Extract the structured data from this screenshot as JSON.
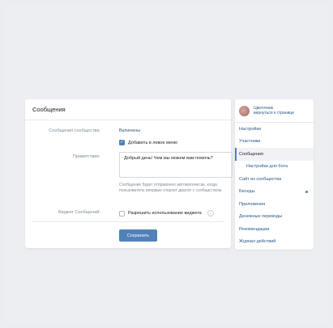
{
  "header": {
    "title": "Сообщения"
  },
  "settings": {
    "community_messages_label": "Сообщения сообщества:",
    "community_messages_value": "Включены",
    "add_left_menu_label": "Добавить в левое меню",
    "add_left_menu_checked": true,
    "greeting_label": "Приветствие:",
    "greeting_value": "Добрый день! Чем мы можем вам помочь?",
    "greeting_hint": "Сообщение будет отправлено автоматически, когда пользователь впервые откроет диалог с сообществом.",
    "widget_label": "Виджет Сообщений:",
    "widget_option_label": "Разрешить использование виджета",
    "widget_checked": false,
    "help_icon_glyph": "?",
    "save_label": "Сохранить"
  },
  "sidebar": {
    "community_name": "Цветочник",
    "back_link": "вернуться к странице",
    "items": [
      {
        "label": "Настройки"
      },
      {
        "label": "Участники"
      },
      {
        "label": "Сообщения",
        "active": true
      },
      {
        "label": "Настройки для бота",
        "sub": true
      },
      {
        "label": "Сайт из сообщества"
      },
      {
        "label": "Беседы",
        "dot": true
      },
      {
        "label": "Приложения"
      },
      {
        "label": "Денежные переводы"
      },
      {
        "label": "Рекомендации"
      },
      {
        "label": "Журнал действий"
      }
    ]
  },
  "colors": {
    "accent": "#5181b8",
    "link": "#2a5885",
    "muted": "#818c99",
    "background": "#edeef2"
  }
}
